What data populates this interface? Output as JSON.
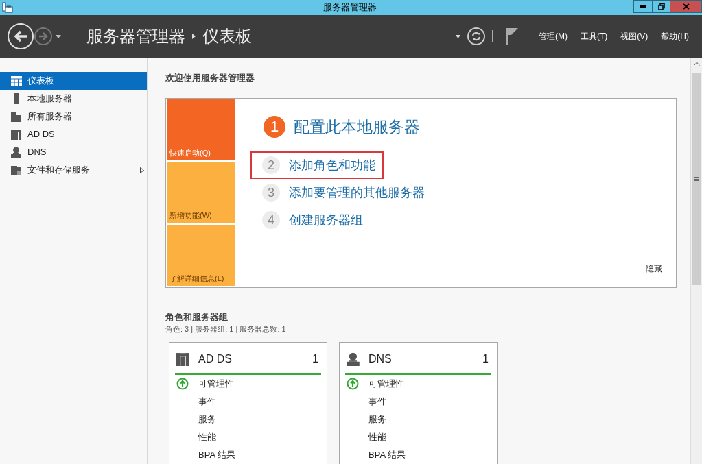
{
  "window": {
    "title": "服务器管理器"
  },
  "header": {
    "breadcrumb": [
      "服务器管理器",
      "仪表板"
    ],
    "menus": [
      "管理(M)",
      "工具(T)",
      "视图(V)",
      "帮助(H)"
    ]
  },
  "sidebar": {
    "items": [
      {
        "label": "仪表板",
        "selected": true,
        "expandable": false
      },
      {
        "label": "本地服务器",
        "selected": false,
        "expandable": false
      },
      {
        "label": "所有服务器",
        "selected": false,
        "expandable": false
      },
      {
        "label": "AD DS",
        "selected": false,
        "expandable": false
      },
      {
        "label": "DNS",
        "selected": false,
        "expandable": false
      },
      {
        "label": "文件和存储服务",
        "selected": false,
        "expandable": true
      }
    ]
  },
  "welcome": {
    "title": "欢迎使用服务器管理器",
    "tiles": [
      {
        "label": "快速启动(Q)",
        "color": "#f26522"
      },
      {
        "label": "新增功能(W)",
        "color": "#fbb040"
      },
      {
        "label": "了解详细信息(L)",
        "color": "#fbb040"
      }
    ],
    "steps": [
      {
        "number": "1",
        "label": "配置此本地服务器",
        "kind": "primary",
        "highlighted": false
      },
      {
        "number": "2",
        "label": "添加角色和功能",
        "kind": "secondary",
        "highlighted": true
      },
      {
        "number": "3",
        "label": "添加要管理的其他服务器",
        "kind": "secondary",
        "highlighted": false
      },
      {
        "number": "4",
        "label": "创建服务器组",
        "kind": "secondary",
        "highlighted": false
      }
    ],
    "hide": "隐藏"
  },
  "roles": {
    "title": "角色和服务器组",
    "summary": "角色: 3 | 服务器组: 1 | 服务器总数: 1",
    "cards": [
      {
        "name": "AD DS",
        "count": "1",
        "rows": [
          {
            "label": "可管理性",
            "ok": true
          },
          {
            "label": "事件",
            "ok": false
          },
          {
            "label": "服务",
            "ok": false
          },
          {
            "label": "性能",
            "ok": false
          },
          {
            "label": "BPA 结果",
            "ok": false
          }
        ]
      },
      {
        "name": "DNS",
        "count": "1",
        "rows": [
          {
            "label": "可管理性",
            "ok": true
          },
          {
            "label": "事件",
            "ok": false
          },
          {
            "label": "服务",
            "ok": false
          },
          {
            "label": "性能",
            "ok": false
          },
          {
            "label": "BPA 结果",
            "ok": false
          }
        ]
      }
    ]
  }
}
